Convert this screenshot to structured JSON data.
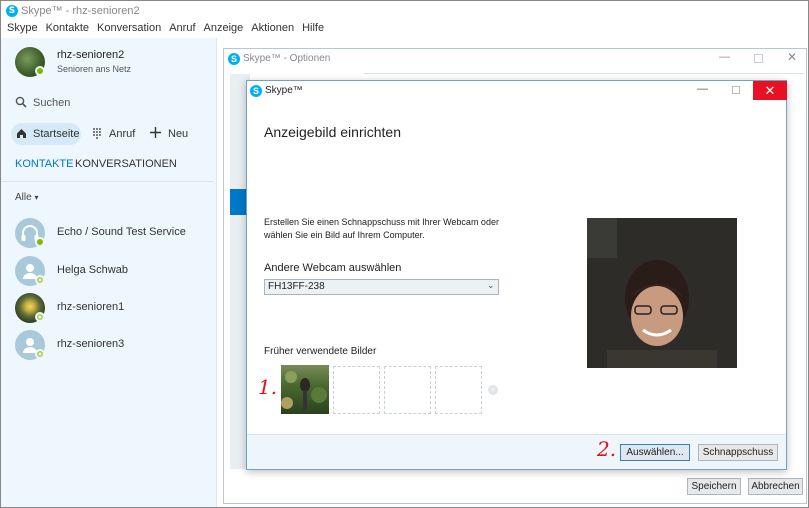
{
  "window": {
    "title": "Skype™ - rhz-senioren2",
    "logo": "S"
  },
  "menu": [
    "Skype",
    "Kontakte",
    "Konversation",
    "Anruf",
    "Anzeige",
    "Aktionen",
    "Hilfe"
  ],
  "profile": {
    "name": "rhz-senioren2",
    "mood": "Senioren ans Netz"
  },
  "search": {
    "label": "Suchen"
  },
  "nav": {
    "home": "Startseite",
    "call": "Anruf",
    "new": "Neu"
  },
  "tabs": {
    "contacts": "KONTAKTE",
    "conversations": "KONVERSATIONEN"
  },
  "filter": {
    "label": "Alle"
  },
  "contacts": [
    {
      "name": "Echo / Sound Test Service"
    },
    {
      "name": "Helga Schwab"
    },
    {
      "name": "rhz-senioren1"
    },
    {
      "name": "rhz-senioren3"
    }
  ],
  "options_window": {
    "title": "Skype™ - Optionen",
    "save": "Speichern",
    "cancel": "Abbrechen"
  },
  "dialog": {
    "title": "Skype™",
    "heading": "Anzeigebild einrichten",
    "description_line1": "Erstellen Sie einen Schnappschuss mit Ihrer Webcam oder",
    "description_line2": "wählen Sie ein Bild auf Ihrem Computer.",
    "webcam_label": "Andere Webcam auswählen",
    "webcam_value": "FH13FF-238",
    "previous_label": "Früher verwendete Bilder",
    "choose_button": "Auswählen...",
    "snapshot_button": "Schnappschuss"
  },
  "annotations": {
    "one": "1.",
    "two": "2."
  },
  "colors": {
    "skype_blue": "#00aff0",
    "status_green": "#7fba00",
    "close_red": "#e81123",
    "accent_blue": "#0078c8",
    "annotation_red": "#e0101a"
  }
}
